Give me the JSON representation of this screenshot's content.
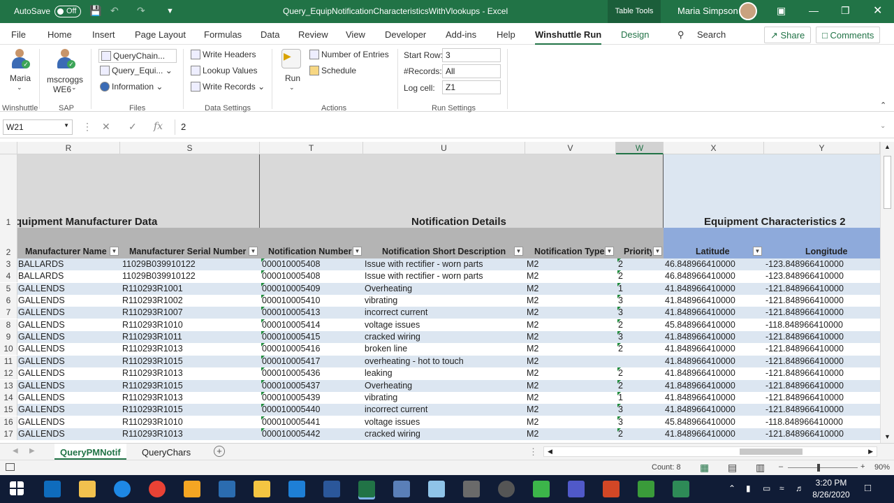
{
  "titlebar": {
    "autosave": "AutoSave",
    "toggle": "Off",
    "filename": "Query_EquipNotificationCharacteristicsWithVlookups  -  Excel",
    "table_tools": "Table Tools",
    "user": "Maria Simpson"
  },
  "menu": {
    "file": "File",
    "home": "Home",
    "insert": "Insert",
    "page_layout": "Page Layout",
    "formulas": "Formulas",
    "data": "Data",
    "review": "Review",
    "view": "View",
    "developer": "Developer",
    "addins": "Add-ins",
    "help": "Help",
    "winshuttle_run": "Winshuttle Run",
    "design": "Design",
    "search": "Search",
    "share": "Share",
    "comments": "Comments"
  },
  "ribbon": {
    "maria": "Maria",
    "mscroggs": "mscroggs",
    "we6": "WE6",
    "group_winshuttle": "Winshuttle",
    "group_sap": "SAP",
    "querychain": "QueryChain...",
    "query_equi": "Query_Equi...",
    "information": "Information",
    "group_files": "Files",
    "write_headers": "Write Headers",
    "lookup_values": "Lookup Values",
    "write_records": "Write Records",
    "group_data_settings": "Data Settings",
    "run": "Run",
    "number_of_entries": "Number of Entries",
    "schedule": "Schedule",
    "group_actions": "Actions",
    "start_row_label": "Start Row:",
    "start_row": "3",
    "records_label": "#Records:",
    "records": "All",
    "log_cell_label": "Log cell:",
    "log_cell": "Z1",
    "group_run_settings": "Run Settings"
  },
  "formula_bar": {
    "name_box": "W21",
    "fx": "fx",
    "value": "2"
  },
  "columns": [
    "R",
    "S",
    "T",
    "U",
    "V",
    "W",
    "X",
    "Y"
  ],
  "bands": {
    "manufacturer": "quipment Manufacturer Data",
    "notification": "Notification Details",
    "characteristics": "Equipment Characteristics 2"
  },
  "headers": [
    "Manufacturer Name",
    "Manufacturer Serial Number",
    "Notification Number",
    "Notification Short Description",
    "Notification Type",
    "Priority",
    "Latitude",
    "Longitude"
  ],
  "row_numbers": [
    "1",
    "2",
    "3",
    "4",
    "5",
    "6",
    "7",
    "8",
    "9",
    "10",
    "11",
    "12",
    "13",
    "14",
    "15",
    "16",
    "17"
  ],
  "rows": [
    [
      "BALLARDS",
      "11029B039910122",
      "000010005408",
      "Issue with rectifier - worn parts",
      "M2",
      "2",
      "46.848966410000",
      "-123.848966410000"
    ],
    [
      "BALLARDS",
      "11029B039910122",
      "000010005408",
      "Issue with rectifier - worn parts",
      "M2",
      "2",
      "46.848966410000",
      "-123.848966410000"
    ],
    [
      "GALLENDS",
      "R110293R1001",
      "000010005409",
      "Overheating",
      "M2",
      "1",
      "41.848966410000",
      "-121.848966410000"
    ],
    [
      "GALLENDS",
      "R110293R1002",
      "000010005410",
      "vibrating",
      "M2",
      "3",
      "41.848966410000",
      "-121.848966410000"
    ],
    [
      "GALLENDS",
      "R110293R1007",
      "000010005413",
      "incorrect current",
      "M2",
      "3",
      "41.848966410000",
      "-121.848966410000"
    ],
    [
      "GALLENDS",
      "R110293R1010",
      "000010005414",
      "voltage issues",
      "M2",
      "2",
      "45.848966410000",
      "-118.848966410000"
    ],
    [
      "GALLENDS",
      "R110293R1011",
      "000010005415",
      "cracked wiring",
      "M2",
      "3",
      "41.848966410000",
      "-121.848966410000"
    ],
    [
      "GALLENDS",
      "R110293R1013",
      "000010005416",
      "broken line",
      "M2",
      "2",
      "41.848966410000",
      "-121.848966410000"
    ],
    [
      "GALLENDS",
      "R110293R1015",
      "000010005417",
      "overheating - hot to touch",
      "M2",
      "",
      "41.848966410000",
      "-121.848966410000"
    ],
    [
      "GALLENDS",
      "R110293R1013",
      "000010005436",
      "leaking",
      "M2",
      "2",
      "41.848966410000",
      "-121.848966410000"
    ],
    [
      "GALLENDS",
      "R110293R1015",
      "000010005437",
      "Overheating",
      "M2",
      "2",
      "41.848966410000",
      "-121.848966410000"
    ],
    [
      "GALLENDS",
      "R110293R1013",
      "000010005439",
      "vibrating",
      "M2",
      "1",
      "41.848966410000",
      "-121.848966410000"
    ],
    [
      "GALLENDS",
      "R110293R1015",
      "000010005440",
      "incorrect current",
      "M2",
      "3",
      "41.848966410000",
      "-121.848966410000"
    ],
    [
      "GALLENDS",
      "R110293R1010",
      "000010005441",
      "voltage issues",
      "M2",
      "3",
      "45.848966410000",
      "-118.848966410000"
    ],
    [
      "GALLENDS",
      "R110293R1013",
      "000010005442",
      "cracked wiring",
      "M2",
      "2",
      "41.848966410000",
      "-121.848966410000"
    ]
  ],
  "sheets": {
    "active": "QueryPMNotif",
    "other": "QueryChars"
  },
  "status": {
    "count": "Count: 8",
    "zoom": "90%"
  },
  "taskbar": {
    "time": "3:20 PM",
    "date": "8/26/2020"
  },
  "colors": {
    "excel_green": "#217346",
    "band_gray": "#d9d9d9",
    "header_gray": "#b4b4b4",
    "char_band": "#dce6f1",
    "char_header": "#8eaadb",
    "row_stripe": "#dce6f1"
  }
}
